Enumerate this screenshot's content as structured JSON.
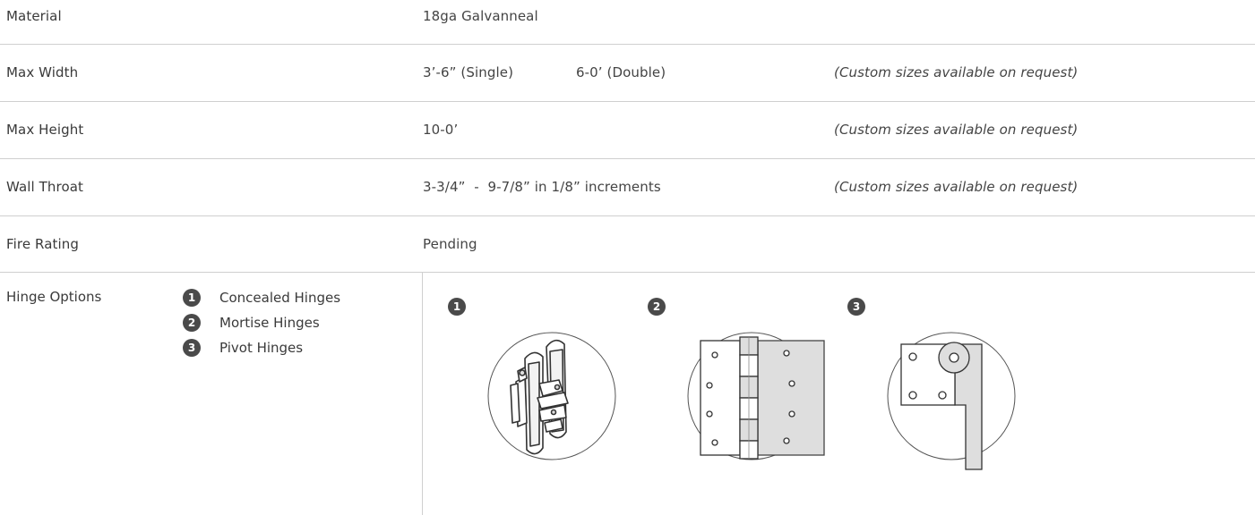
{
  "specs": [
    {
      "label": "Material",
      "value_a": "18ga Galvanneal",
      "value_b": "",
      "note": ""
    },
    {
      "label": "Max Width",
      "value_a": "3’-6” (Single)",
      "value_b": "6-0’ (Double)",
      "note": "(Custom sizes available on request)"
    },
    {
      "label": "Max Height",
      "value_a": "10-0’",
      "value_b": "",
      "note": "(Custom sizes available on request)"
    },
    {
      "label": "Wall Throat",
      "value_a": "3-3/4”  -  9-7/8” in 1/8” increments",
      "value_b": "",
      "note": "(Custom sizes available on request)"
    },
    {
      "label": "Fire Rating",
      "value_a": "Pending",
      "value_b": "",
      "note": ""
    }
  ],
  "hinges": {
    "label": "Hinge Options",
    "items": [
      {
        "number": "1",
        "label": "Concealed Hinges",
        "icon": "concealed-hinge-icon"
      },
      {
        "number": "2",
        "label": "Mortise Hinges",
        "icon": "mortise-hinge-icon"
      },
      {
        "number": "3",
        "label": "Pivot Hinges",
        "icon": "pivot-hinge-icon"
      }
    ]
  },
  "colors": {
    "text": "#3c3c3c",
    "divider": "#cfcfcf",
    "badge": "#4a4a4a",
    "hinge_fill": "#dedede"
  }
}
